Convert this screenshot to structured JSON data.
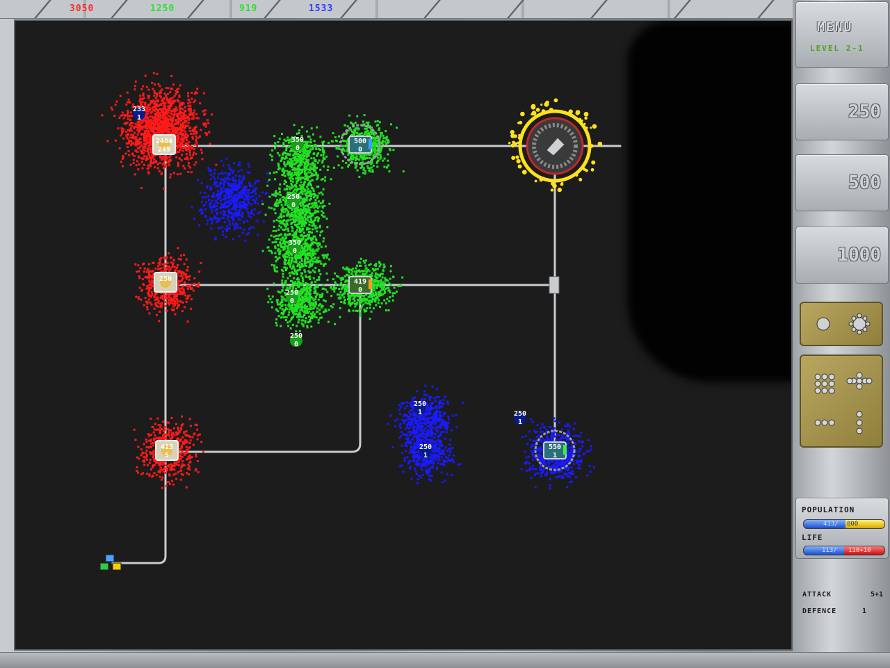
{
  "scores": {
    "red": {
      "value": "3050",
      "color": "#ff2a2a"
    },
    "green1": {
      "value": "1250",
      "color": "#2ee02e"
    },
    "green2": {
      "value": "919",
      "color": "#2ee02e"
    },
    "blue": {
      "value": "1533",
      "color": "#2a3cff"
    }
  },
  "panel": {
    "menu_label": "MENU",
    "level_label": "LEVEL 2-1",
    "buttons": [
      "250",
      "500",
      "1000"
    ],
    "formation_icons": [
      "single-orb-icon",
      "spiked-orb-icon",
      "grid-formation-icon",
      "diamond-formation-icon",
      "row-formation-icon",
      "column-formation-icon"
    ],
    "population": {
      "label": "POPULATION",
      "current": "413/",
      "max": "800",
      "fill": 0.52
    },
    "life": {
      "label": "LIFE",
      "current": "113/",
      "max": "110+10",
      "fill": 0.5
    },
    "attack": {
      "label": "ATTACK",
      "value": "5+1"
    },
    "defence": {
      "label": "DEFENCE",
      "value": "1"
    }
  },
  "colors": {
    "red": "#ff1a1a",
    "green": "#22e022",
    "blue": "#1a1aff",
    "yellow": "#ffe21a",
    "path": "#c9cdd1"
  },
  "nodes": [
    {
      "id": "red-base-top",
      "label1": "2404",
      "label2": "249",
      "team": "red"
    },
    {
      "id": "red-base-mid",
      "label1": "250",
      "label2": "",
      "team": "red"
    },
    {
      "id": "red-base-bottom",
      "label1": "413",
      "label2": "5",
      "team": "red"
    },
    {
      "id": "green-base-top",
      "label1": "500",
      "label2": "0",
      "team": "green"
    },
    {
      "id": "green-base-mid",
      "label1": "419",
      "label2": "0",
      "team": "green"
    },
    {
      "id": "neutral-yellow",
      "label1": "",
      "label2": "",
      "team": "yellow"
    },
    {
      "id": "blue-base",
      "label1": "550",
      "label2": "1",
      "team": "blue"
    }
  ],
  "squads": [
    {
      "label1": "233",
      "label2": "1",
      "team": "blue"
    },
    {
      "label1": "350",
      "label2": "0",
      "team": "green"
    },
    {
      "label1": "250",
      "label2": "0",
      "team": "green"
    },
    {
      "label1": "350",
      "label2": "0",
      "team": "green"
    },
    {
      "label1": "250",
      "label2": "0",
      "team": "green"
    },
    {
      "label1": "250",
      "label2": "0",
      "team": "green"
    },
    {
      "label1": "250",
      "label2": "1",
      "team": "blue"
    },
    {
      "label1": "250",
      "label2": "1",
      "team": "blue"
    },
    {
      "label1": "250",
      "label2": "1",
      "team": "blue"
    }
  ]
}
